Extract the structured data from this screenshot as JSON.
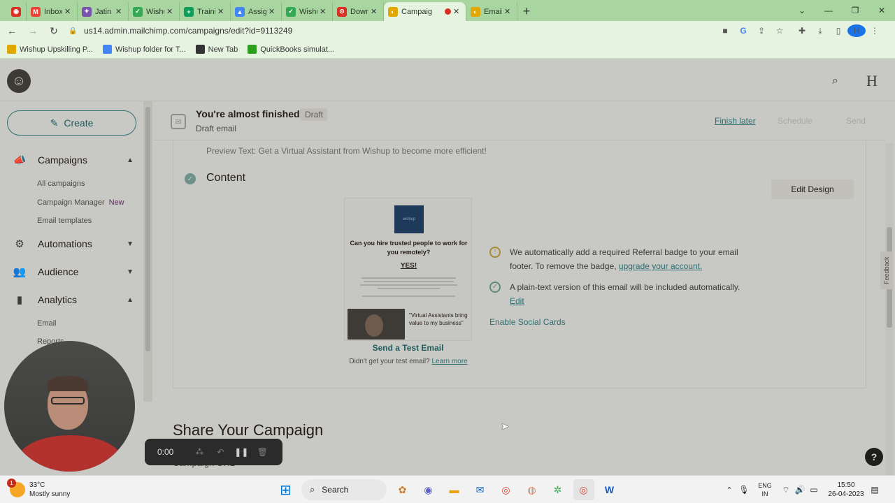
{
  "browser": {
    "tabs": [
      {
        "label": "",
        "fav_color": "#d93025",
        "fav_glyph": "◉"
      },
      {
        "label": "Inbox - himar",
        "fav_color": "#ea4335",
        "fav_glyph": "M"
      },
      {
        "label": "Jatin Kelkar -",
        "fav_color": "#7b52ab",
        "fav_glyph": "✦"
      },
      {
        "label": "Wishup App",
        "fav_color": "#34a853",
        "fav_glyph": "✓"
      },
      {
        "label": "TrainingMod",
        "fav_color": "#0f9d58",
        "fav_glyph": "+"
      },
      {
        "label": "Assignments",
        "fav_color": "#4285f4",
        "fav_glyph": "▲"
      },
      {
        "label": "Wishup - Top",
        "fav_color": "#34a853",
        "fav_glyph": "✓"
      },
      {
        "label": "Download yo",
        "fav_color": "#d93025",
        "fav_glyph": "⊙"
      },
      {
        "label": "Campaig",
        "fav_color": "#e0a800",
        "fav_glyph": "◐",
        "active": true
      },
      {
        "label": "Email dashbo",
        "fav_color": "#e0a800",
        "fav_glyph": "◐"
      }
    ],
    "url": "us14.admin.mailchimp.com/campaigns/edit?id=9113249",
    "profile_initial": "H",
    "bookmarks": [
      {
        "label": "Wishup Upskilling P...",
        "color": "#e0a800"
      },
      {
        "label": "Wishup folder for T...",
        "color": "#4285f4"
      },
      {
        "label": "New Tab",
        "color": "#333333"
      },
      {
        "label": "QuickBooks simulat...",
        "color": "#2ca01c"
      }
    ]
  },
  "topbar": {
    "user_initial": "H"
  },
  "sidebar": {
    "create_label": "Create",
    "sections": [
      {
        "label": "Campaigns",
        "icon": "megaphone-icon",
        "glyph": "📣",
        "chevron": "▲"
      },
      {
        "label": "Automations",
        "icon": "automation-icon",
        "glyph": "⚙",
        "chevron": "▼"
      },
      {
        "label": "Audience",
        "icon": "audience-icon",
        "glyph": "👥",
        "chevron": "▼"
      },
      {
        "label": "Analytics",
        "icon": "analytics-icon",
        "glyph": "▮",
        "chevron": "▲"
      }
    ],
    "campaign_items": [
      "All campaigns",
      "Campaign Manager",
      "Email templates"
    ],
    "new_badge": "New",
    "analytics_items": [
      "Email",
      "Reports"
    ]
  },
  "finish_bar": {
    "title": "You're almost finished!",
    "badge": "Draft",
    "subtitle": "Draft email",
    "finish_later": "Finish later",
    "schedule": "Schedule",
    "send": "Send"
  },
  "content_card": {
    "preview_text": "Preview Text: Get a Virtual Assistant from Wishup to become more efficient!",
    "heading": "Content",
    "edit_design": "Edit Design",
    "thumbnail": {
      "logo_text": "wishup",
      "headline": "Can you hire trusted people to work for you remotely?",
      "yes": "YES!",
      "quote": "\"Virtual Assistants bring value to my business\""
    },
    "send_test": "Send a Test Email",
    "didnt_get": "Didn't get your test email?",
    "learn_more": "Learn more",
    "referral_note": "We automatically add a required Referral badge to your email footer. To remove the badge,",
    "referral_link": "upgrade your account.",
    "plaintext_note": "A plain-text version of this email will be included automatically.",
    "plaintext_link": "Edit",
    "social_cards": "Enable Social Cards"
  },
  "share": {
    "heading": "Share Your Campaign",
    "campaign_url_label": "Campaign URL"
  },
  "feedback_label": "Feedback",
  "help_label": "?",
  "recorder": {
    "time": "0:00"
  },
  "taskbar": {
    "notif_count": "1",
    "temperature": "33°C",
    "condition": "Mostly sunny",
    "search_label": "Search",
    "lang_top": "ENG",
    "lang_bottom": "IN",
    "time": "15:50",
    "date": "26-04-2023"
  }
}
